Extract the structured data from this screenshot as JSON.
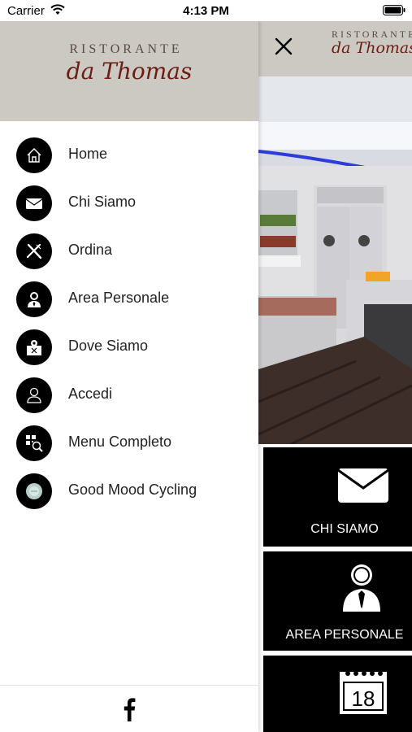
{
  "status_bar": {
    "carrier": "Carrier",
    "time": "4:13 PM"
  },
  "drawer": {
    "logo": {
      "top": "RISTORANTE",
      "script": "da Thomas"
    },
    "items": [
      {
        "label": "Home",
        "icon": "home-icon"
      },
      {
        "label": "Chi Siamo",
        "icon": "envelope-icon"
      },
      {
        "label": "Ordina",
        "icon": "cutlery-icon"
      },
      {
        "label": "Area Personale",
        "icon": "user-tie-icon"
      },
      {
        "label": "Dove Siamo",
        "icon": "map-pin-icon"
      },
      {
        "label": "Accedi",
        "icon": "person-icon"
      },
      {
        "label": "Menu Completo",
        "icon": "qr-search-icon"
      },
      {
        "label": "Good Mood Cycling",
        "icon": "cycling-logo-icon"
      }
    ],
    "footer_icon": "facebook-icon"
  },
  "background_app": {
    "logo": {
      "top": "RISTORANTE",
      "script": "da Thomas"
    },
    "tiles": [
      {
        "label": "CHI SIAMO",
        "icon": "envelope-icon"
      },
      {
        "label": "AREA PERSONALE",
        "icon": "user-tie-icon"
      },
      {
        "label": "",
        "icon": "calendar-icon",
        "number": "18"
      }
    ]
  },
  "colors": {
    "header_bg": "#ccc8c2",
    "logo_dark_red": "#6a1e14",
    "tile_bg": "#000000"
  }
}
